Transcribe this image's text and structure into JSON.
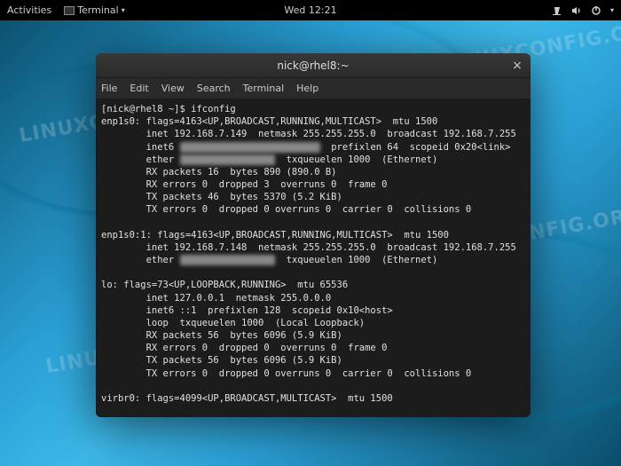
{
  "topbar": {
    "activities": "Activities",
    "terminal_label": "Terminal",
    "clock": "Wed 12:21",
    "icons": {
      "network": "network-icon",
      "volume": "volume-icon",
      "power": "power-icon",
      "dropdown": "▾"
    }
  },
  "watermark": "LINUXCONFIG.ORG",
  "window": {
    "title": "nick@rhel8:~",
    "close": "×"
  },
  "menu": {
    "file": "File",
    "edit": "Edit",
    "view": "View",
    "search": "Search",
    "terminal": "Terminal",
    "help": "Help"
  },
  "term": {
    "prompt": "[nick@rhel8 ~]$ ",
    "cmd": "ifconfig",
    "if_enp1s0_l1": "enp1s0: flags=4163<UP,BROADCAST,RUNNING,MULTICAST>  mtu 1500",
    "if_enp1s0_l2": "        inet 192.168.7.149  netmask 255.255.255.0  broadcast 192.168.7.255",
    "if_enp1s0_l3_a": "        inet6 ",
    "if_enp1s0_l3_mask": "fe80::xxxx:xxxx:xxxx:xxxx",
    "if_enp1s0_l3_b": "  prefixlen 64  scopeid 0x20<link>",
    "if_enp1s0_l4_a": "        ether ",
    "if_enp1s0_l4_mask": "xx:xx:xx:xx:xx:xx",
    "if_enp1s0_l4_b": "  txqueuelen 1000  (Ethernet)",
    "if_enp1s0_l5": "        RX packets 16  bytes 890 (890.0 B)",
    "if_enp1s0_l6": "        RX errors 0  dropped 3  overruns 0  frame 0",
    "if_enp1s0_l7": "        TX packets 46  bytes 5370 (5.2 KiB)",
    "if_enp1s0_l8": "        TX errors 0  dropped 0 overruns 0  carrier 0  collisions 0",
    "blank": "",
    "if_alias_l1": "enp1s0:1: flags=4163<UP,BROADCAST,RUNNING,MULTICAST>  mtu 1500",
    "if_alias_l2": "        inet 192.168.7.148  netmask 255.255.255.0  broadcast 192.168.7.255",
    "if_alias_l3_a": "        ether ",
    "if_alias_l3_mask": "xx:xx:xx:xx:xx:xx",
    "if_alias_l3_b": "  txqueuelen 1000  (Ethernet)",
    "if_lo_l1": "lo: flags=73<UP,LOOPBACK,RUNNING>  mtu 65536",
    "if_lo_l2": "        inet 127.0.0.1  netmask 255.0.0.0",
    "if_lo_l3": "        inet6 ::1  prefixlen 128  scopeid 0x10<host>",
    "if_lo_l4": "        loop  txqueuelen 1000  (Local Loopback)",
    "if_lo_l5": "        RX packets 56  bytes 6096 (5.9 KiB)",
    "if_lo_l6": "        RX errors 0  dropped 0  overruns 0  frame 0",
    "if_lo_l7": "        TX packets 56  bytes 6096 (5.9 KiB)",
    "if_lo_l8": "        TX errors 0  dropped 0 overruns 0  carrier 0  collisions 0",
    "if_virbr0_l1": "virbr0: flags=4099<UP,BROADCAST,MULTICAST>  mtu 1500"
  }
}
